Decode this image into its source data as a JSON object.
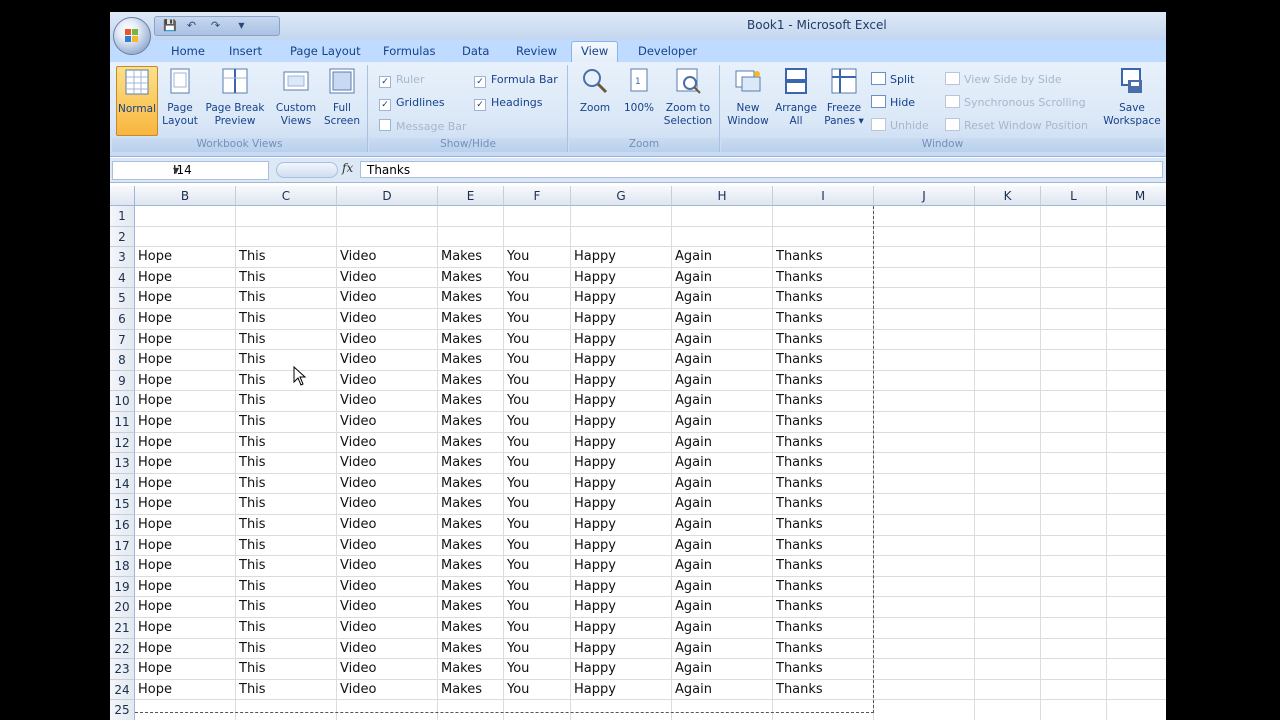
{
  "window": {
    "title": "Book1 - Microsoft Excel"
  },
  "quick_access": {
    "icons": [
      "save-icon",
      "undo-icon",
      "redo-icon"
    ]
  },
  "tabs": [
    {
      "label": "Home",
      "active": false
    },
    {
      "label": "Insert",
      "active": false
    },
    {
      "label": "Page Layout",
      "active": false
    },
    {
      "label": "Formulas",
      "active": false
    },
    {
      "label": "Data",
      "active": false
    },
    {
      "label": "Review",
      "active": false
    },
    {
      "label": "View",
      "active": true
    },
    {
      "label": "Developer",
      "active": false
    }
  ],
  "ribbon": {
    "workbook_views": {
      "label": "Workbook Views",
      "normal": [
        "Normal",
        ""
      ],
      "page_layout": [
        "Page",
        "Layout"
      ],
      "page_break": [
        "Page Break",
        "Preview"
      ],
      "custom_views": [
        "Custom",
        "Views"
      ],
      "full_screen": [
        "Full",
        "Screen"
      ]
    },
    "show_hide": {
      "label": "Show/Hide",
      "ruler": "Ruler",
      "gridlines": "Gridlines",
      "message_bar": "Message Bar",
      "formula_bar": "Formula Bar",
      "headings": "Headings"
    },
    "zoom": {
      "label": "Zoom",
      "zoom": [
        "Zoom",
        ""
      ],
      "hundred": [
        "100%",
        ""
      ],
      "zoom_to_selection": [
        "Zoom to",
        "Selection"
      ]
    },
    "window": {
      "label": "Window",
      "new_window": [
        "New",
        "Window"
      ],
      "arrange_all": [
        "Arrange",
        "All"
      ],
      "freeze_panes": [
        "Freeze",
        "Panes ▾"
      ],
      "split": "Split",
      "hide": "Hide",
      "unhide": "Unhide",
      "view_side_by_side": "View Side by Side",
      "synchronous_scrolling": "Synchronous Scrolling",
      "reset_window_position": "Reset Window Position",
      "save_workspace": [
        "Save",
        "Workspace"
      ]
    }
  },
  "formula_bar": {
    "name_box": "I14",
    "formula": "Thanks"
  },
  "sheet": {
    "columns": [
      "B",
      "C",
      "D",
      "E",
      "F",
      "G",
      "H",
      "I",
      "J",
      "K",
      "L",
      "M"
    ],
    "rows": [
      {
        "num": "1",
        "cells": []
      },
      {
        "num": "2",
        "cells": []
      },
      {
        "num": "3",
        "cells": [
          "Hope",
          "This",
          "Video",
          "Makes",
          "You",
          "Happy",
          "Again",
          "Thanks"
        ]
      },
      {
        "num": "4",
        "cells": [
          "Hope",
          "This",
          "Video",
          "Makes",
          "You",
          "Happy",
          "Again",
          "Thanks"
        ]
      },
      {
        "num": "5",
        "cells": [
          "Hope",
          "This",
          "Video",
          "Makes",
          "You",
          "Happy",
          "Again",
          "Thanks"
        ]
      },
      {
        "num": "6",
        "cells": [
          "Hope",
          "This",
          "Video",
          "Makes",
          "You",
          "Happy",
          "Again",
          "Thanks"
        ]
      },
      {
        "num": "7",
        "cells": [
          "Hope",
          "This",
          "Video",
          "Makes",
          "You",
          "Happy",
          "Again",
          "Thanks"
        ]
      },
      {
        "num": "8",
        "cells": [
          "Hope",
          "This",
          "Video",
          "Makes",
          "You",
          "Happy",
          "Again",
          "Thanks"
        ]
      },
      {
        "num": "9",
        "cells": [
          "Hope",
          "This",
          "Video",
          "Makes",
          "You",
          "Happy",
          "Again",
          "Thanks"
        ]
      },
      {
        "num": "10",
        "cells": [
          "Hope",
          "This",
          "Video",
          "Makes",
          "You",
          "Happy",
          "Again",
          "Thanks"
        ]
      },
      {
        "num": "11",
        "cells": [
          "Hope",
          "This",
          "Video",
          "Makes",
          "You",
          "Happy",
          "Again",
          "Thanks"
        ]
      },
      {
        "num": "12",
        "cells": [
          "Hope",
          "This",
          "Video",
          "Makes",
          "You",
          "Happy",
          "Again",
          "Thanks"
        ]
      },
      {
        "num": "13",
        "cells": [
          "Hope",
          "This",
          "Video",
          "Makes",
          "You",
          "Happy",
          "Again",
          "Thanks"
        ]
      },
      {
        "num": "14",
        "cells": [
          "Hope",
          "This",
          "Video",
          "Makes",
          "You",
          "Happy",
          "Again",
          "Thanks"
        ]
      },
      {
        "num": "15",
        "cells": [
          "Hope",
          "This",
          "Video",
          "Makes",
          "You",
          "Happy",
          "Again",
          "Thanks"
        ]
      },
      {
        "num": "16",
        "cells": [
          "Hope",
          "This",
          "Video",
          "Makes",
          "You",
          "Happy",
          "Again",
          "Thanks"
        ]
      },
      {
        "num": "17",
        "cells": [
          "Hope",
          "This",
          "Video",
          "Makes",
          "You",
          "Happy",
          "Again",
          "Thanks"
        ]
      },
      {
        "num": "18",
        "cells": [
          "Hope",
          "This",
          "Video",
          "Makes",
          "You",
          "Happy",
          "Again",
          "Thanks"
        ]
      },
      {
        "num": "19",
        "cells": [
          "Hope",
          "This",
          "Video",
          "Makes",
          "You",
          "Happy",
          "Again",
          "Thanks"
        ]
      },
      {
        "num": "20",
        "cells": [
          "Hope",
          "This",
          "Video",
          "Makes",
          "You",
          "Happy",
          "Again",
          "Thanks"
        ]
      },
      {
        "num": "21",
        "cells": [
          "Hope",
          "This",
          "Video",
          "Makes",
          "You",
          "Happy",
          "Again",
          "Thanks"
        ]
      },
      {
        "num": "22",
        "cells": [
          "Hope",
          "This",
          "Video",
          "Makes",
          "You",
          "Happy",
          "Again",
          "Thanks"
        ]
      },
      {
        "num": "23",
        "cells": [
          "Hope",
          "This",
          "Video",
          "Makes",
          "You",
          "Happy",
          "Again",
          "Thanks"
        ]
      },
      {
        "num": "24",
        "cells": [
          "Hope",
          "This",
          "Video",
          "Makes",
          "You",
          "Happy",
          "Again",
          "Thanks"
        ]
      },
      {
        "num": "25",
        "cells": []
      }
    ]
  }
}
